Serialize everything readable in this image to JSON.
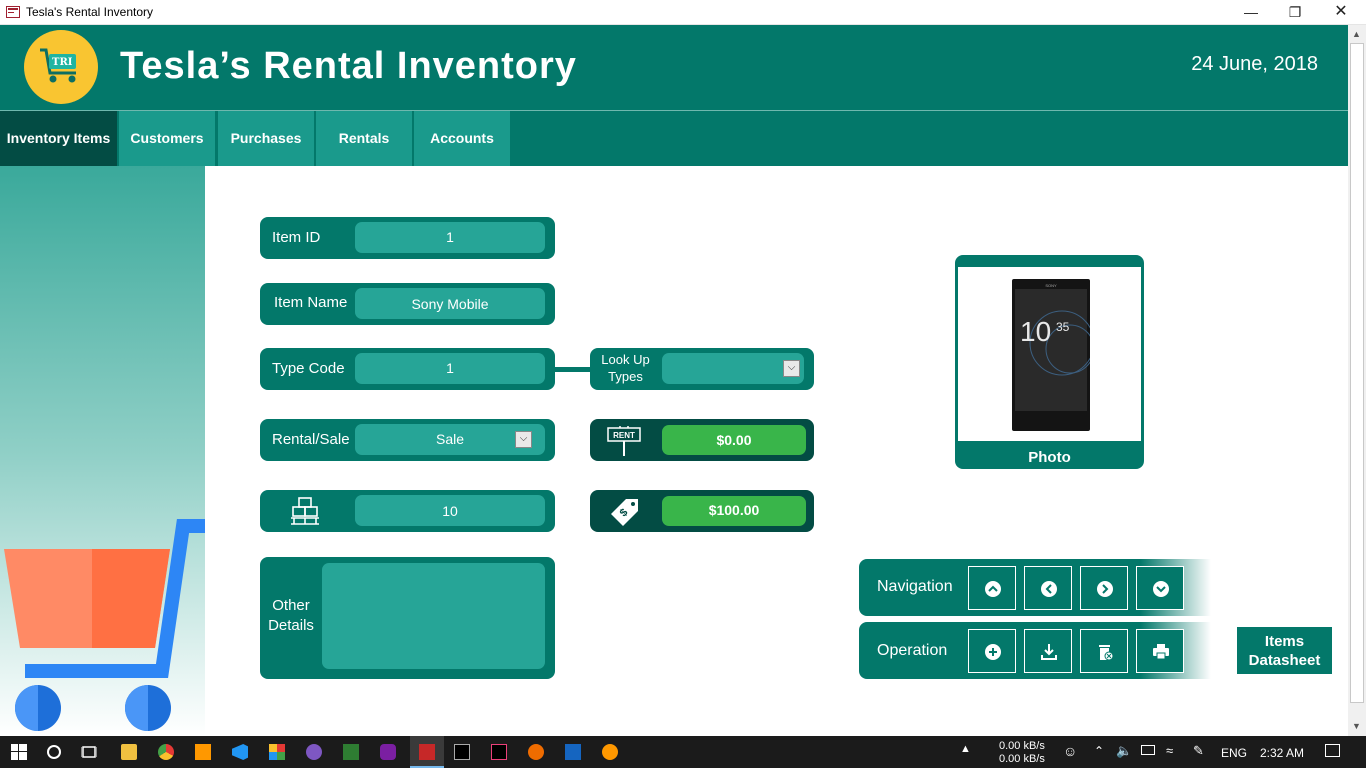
{
  "window": {
    "title": "Tesla's Rental Inventory",
    "controls": {
      "minimize": "—",
      "restore": "❐",
      "close": "✕"
    }
  },
  "header": {
    "logo_text": "TRI",
    "title": "Tesla’s Rental Inventory",
    "date": "24 June, 2018"
  },
  "tabs": [
    {
      "label": "Inventory Items",
      "active": true
    },
    {
      "label": "Customers",
      "active": false
    },
    {
      "label": "Purchases",
      "active": false
    },
    {
      "label": "Rentals",
      "active": false
    },
    {
      "label": "Accounts",
      "active": false
    }
  ],
  "form": {
    "item_id": {
      "label": "Item ID",
      "value": "1"
    },
    "item_name": {
      "label": "Item Name",
      "value": "Sony Mobile"
    },
    "type_code": {
      "label": "Type Code",
      "value": "1"
    },
    "lookup_types": {
      "label": "Look Up Types",
      "value": ""
    },
    "rental_sale": {
      "label": "Rental/Sale",
      "value": "Sale"
    },
    "quantity": {
      "icon": "pallet-icon",
      "value": "10"
    },
    "rent_price": {
      "icon": "rent-sign-icon",
      "icon_text": "RENT",
      "value": "$0.00"
    },
    "sale_price": {
      "icon": "price-tag-icon",
      "value": "$100.00"
    },
    "other_details": {
      "label_line1": "Other",
      "label_line2": "Details",
      "value": ""
    }
  },
  "photo": {
    "label": "Photo",
    "phone_clock_h": "10",
    "phone_clock_m": "35",
    "phone_brand": "SONY"
  },
  "navigation": {
    "label": "Navigation",
    "buttons": [
      "first-record",
      "previous-record",
      "next-record",
      "last-record"
    ]
  },
  "operation": {
    "label": "Operation",
    "buttons": [
      "new-record",
      "save-record",
      "delete-record",
      "print-record"
    ]
  },
  "datasheet": {
    "line1": "Items",
    "line2": "Datasheet"
  },
  "taskbar": {
    "net_up": "0.00 kB/s",
    "net_down": "0.00 kB/s",
    "lang": "ENG",
    "time": "2:32 AM"
  },
  "colors": {
    "primary": "#03786a",
    "dark": "#034c44",
    "field": "#26a597",
    "money": "#39b54a",
    "logo": "#f9c531"
  }
}
